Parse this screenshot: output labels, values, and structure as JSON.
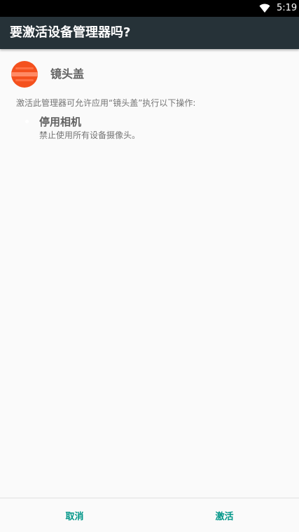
{
  "status_bar": {
    "time": "5:19",
    "wifi_icon": "wifi-icon"
  },
  "dialog": {
    "title": "要激活设备管理器吗?",
    "app_name": "镜头盖",
    "app_icon": "camera-lens-cover-icon",
    "description": "激活此管理器可允许应用“镜头盖”执行以下操作:",
    "permissions": [
      {
        "title": "停用相机",
        "description": "禁止使用所有设备摄像头。"
      }
    ]
  },
  "buttons": {
    "cancel": "取消",
    "activate": "激活"
  },
  "colors": {
    "title_bar": "#263238",
    "accent": "#009688",
    "icon_orange": "#f4511e"
  }
}
